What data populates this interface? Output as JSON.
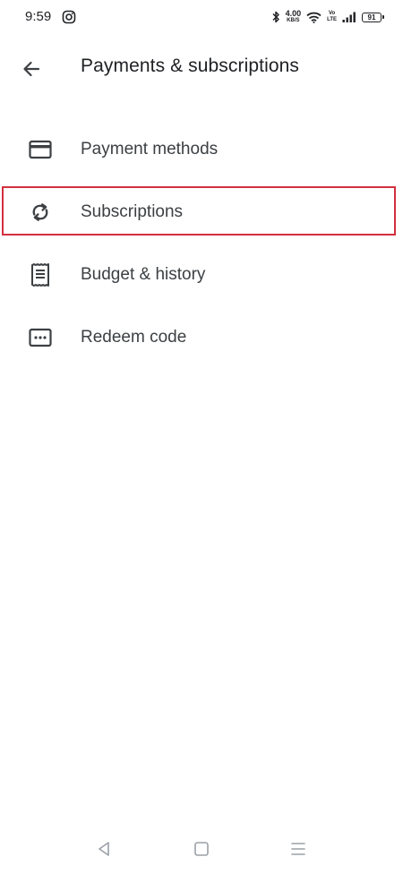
{
  "status_bar": {
    "time": "9:59",
    "net_speed_value": "4.00",
    "net_speed_unit": "KB/S",
    "volte_top": "Vo",
    "volte_bottom": "LTE",
    "battery": "91"
  },
  "app_bar": {
    "title": "Payments & subscriptions"
  },
  "menu": {
    "items": [
      {
        "label": "Payment methods",
        "icon": "credit-card-icon"
      },
      {
        "label": "Subscriptions",
        "icon": "refresh-icon"
      },
      {
        "label": "Budget & history",
        "icon": "receipt-icon"
      },
      {
        "label": "Redeem code",
        "icon": "redeem-code-icon"
      }
    ]
  },
  "colors": {
    "text": "#202124",
    "icon": "#3c4043",
    "highlight": "#d32f3f"
  }
}
